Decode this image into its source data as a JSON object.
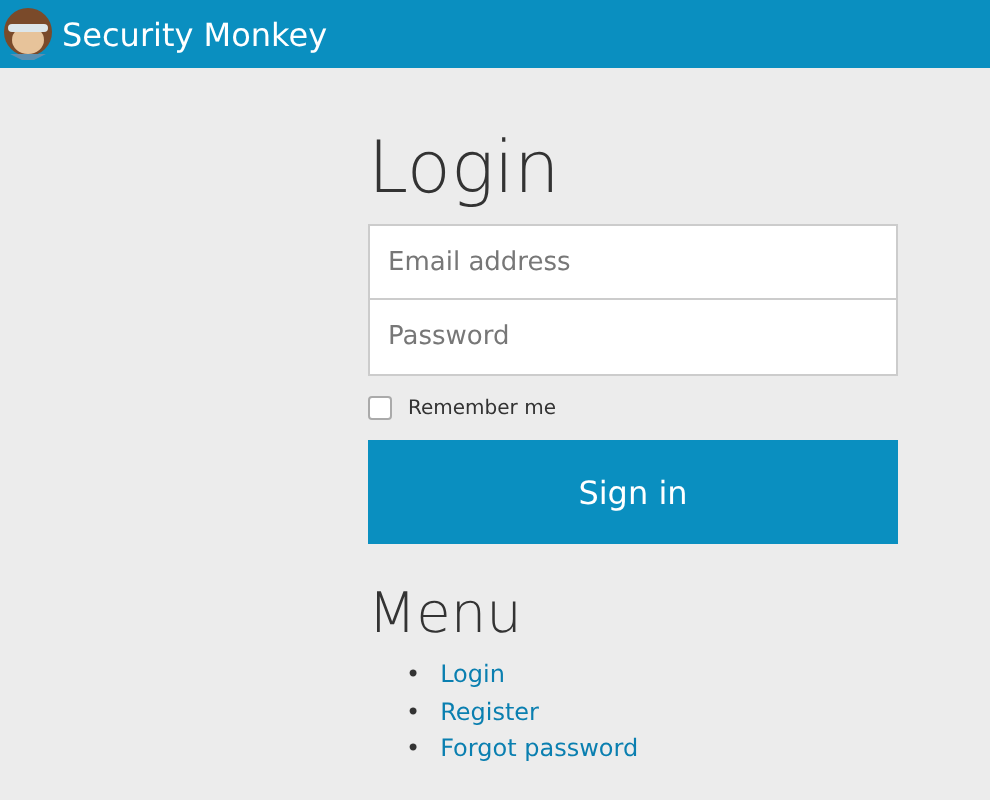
{
  "header": {
    "title": "Security Monkey"
  },
  "login": {
    "heading": "Login",
    "fields": [
      {
        "placeholder": "Email address"
      },
      {
        "placeholder": "Password"
      }
    ],
    "remember": {
      "label": "Remember me",
      "checked": false
    },
    "submit": "Sign in"
  },
  "menu": {
    "heading": "Menu",
    "items": [
      {
        "bullet": "•",
        "label": "Login"
      },
      {
        "bullet": "•",
        "label": "Register"
      },
      {
        "bullet": "•",
        "label": "Forgot password"
      }
    ]
  }
}
